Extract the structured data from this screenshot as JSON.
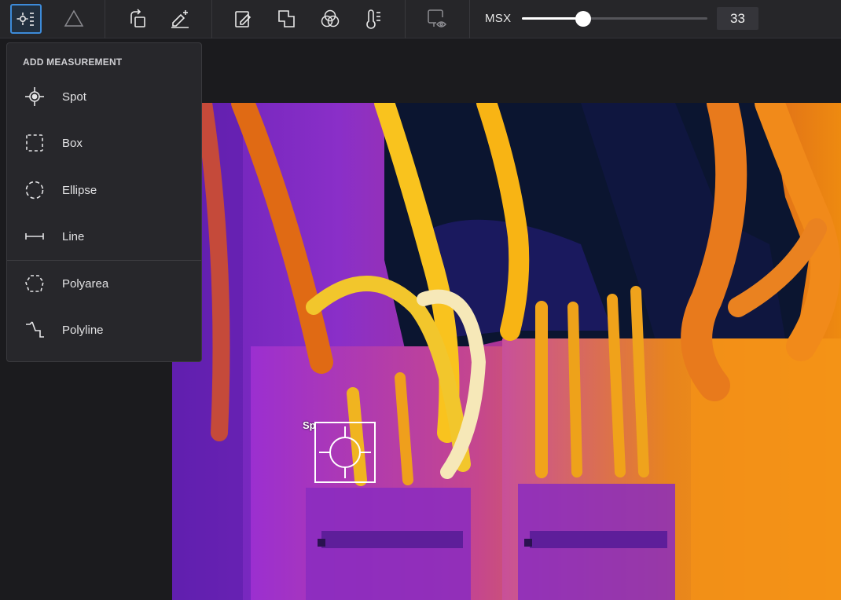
{
  "toolbar": {
    "tools": [
      {
        "name": "measurement-tool",
        "active": true,
        "icon": "measurement-icon"
      },
      {
        "name": "delta-tool",
        "active": false,
        "icon": "triangle-icon"
      },
      {
        "name": "rotate-tool",
        "icon": "rotate-icon"
      },
      {
        "name": "annotate-tool",
        "icon": "pen-add-icon"
      },
      {
        "name": "edit-tool",
        "icon": "edit-icon"
      },
      {
        "name": "overlay-tool",
        "icon": "overlay-icon"
      },
      {
        "name": "color-palette-tool",
        "icon": "color-circles-icon"
      },
      {
        "name": "temperature-scale-tool",
        "icon": "thermometer-icon"
      },
      {
        "name": "visibility-tool",
        "icon": "screen-eye-icon"
      }
    ],
    "msx": {
      "label": "MSX",
      "value": "33",
      "slider_fraction": 0.33
    }
  },
  "measurement_menu": {
    "header": "ADD MEASUREMENT",
    "items": [
      {
        "label": "Spot",
        "icon": "spot-icon"
      },
      {
        "label": "Box",
        "icon": "box-icon"
      },
      {
        "label": "Ellipse",
        "icon": "ellipse-icon"
      },
      {
        "label": "Line",
        "icon": "line-icon"
      },
      {
        "label": "Polyarea",
        "icon": "polyarea-icon"
      },
      {
        "label": "Polyline",
        "icon": "polyline-icon"
      }
    ]
  },
  "image": {
    "spot_marker": {
      "label": "Sp"
    }
  },
  "colors": {
    "accent": "#3d8bd9",
    "toolbar_bg": "#262629",
    "menu_bg": "#27272b"
  }
}
